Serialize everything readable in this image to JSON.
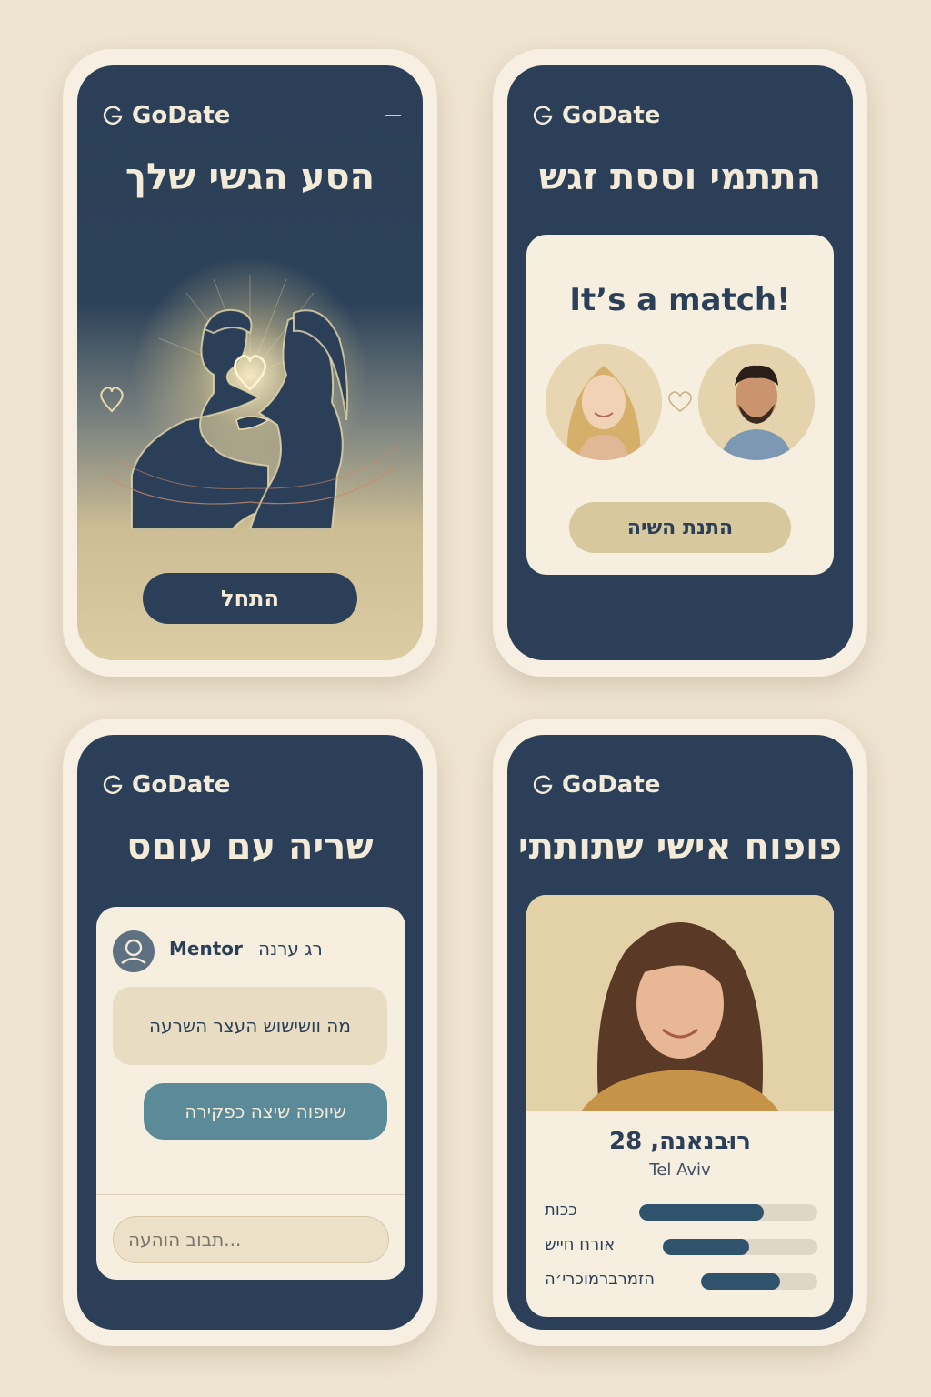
{
  "brand": {
    "name": "GoDate",
    "icon": "g-logo-icon"
  },
  "screen1": {
    "title": "הסע הגשי שלך",
    "button": "התחל"
  },
  "screen2": {
    "title": "התתמי וססת זגש",
    "match_text": "It’s a match!",
    "button": "התנת השיה"
  },
  "screen3": {
    "title": "שריה עם עוםס",
    "mentor_name": "Mentor",
    "mentor_label": "רג ערנה",
    "incoming_message": "מה  וושישוש העצר השרעה",
    "outgoing_message": "שיופוה שיצה כפקירה",
    "input_placeholder": "תבוב הוהעה..."
  },
  "screen4": {
    "title": "פופוח אישי שתותתי",
    "name": "רוּבנאנה, 28",
    "city": "Tel Aviv",
    "traits": [
      {
        "label": "ככות",
        "value": 0.7
      },
      {
        "label": "אורח חייש",
        "value": 0.56
      },
      {
        "label": "הזמרברמוכרי׳ה",
        "value": 0.68
      }
    ]
  },
  "colors": {
    "navy": "#2b4058",
    "cream": "#f6eedf",
    "sand": "#d8c89e",
    "teal": "#5b8a99",
    "background": "#efe4d1"
  }
}
